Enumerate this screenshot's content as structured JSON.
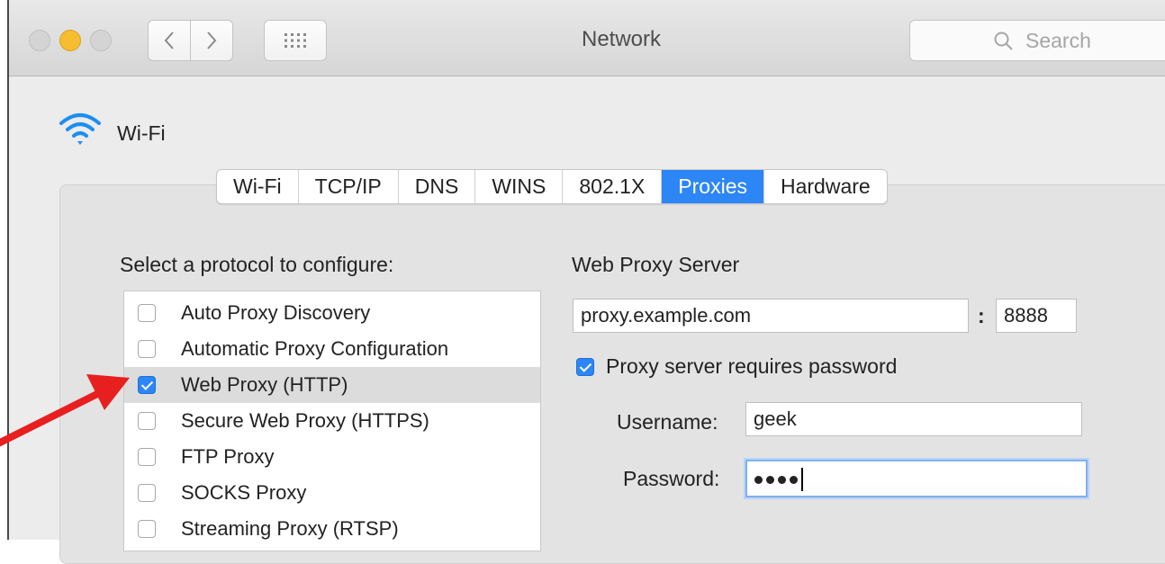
{
  "window": {
    "title": "Network"
  },
  "search": {
    "placeholder": "Search"
  },
  "header": {
    "interface_name": "Wi-Fi"
  },
  "tabs": [
    {
      "label": "Wi-Fi",
      "active": false
    },
    {
      "label": "TCP/IP",
      "active": false
    },
    {
      "label": "DNS",
      "active": false
    },
    {
      "label": "WINS",
      "active": false
    },
    {
      "label": "802.1X",
      "active": false
    },
    {
      "label": "Proxies",
      "active": true
    },
    {
      "label": "Hardware",
      "active": false
    }
  ],
  "protocols": {
    "heading": "Select a protocol to configure:",
    "items": [
      {
        "label": "Auto Proxy Discovery",
        "checked": false,
        "selected": false
      },
      {
        "label": "Automatic Proxy Configuration",
        "checked": false,
        "selected": false
      },
      {
        "label": "Web Proxy (HTTP)",
        "checked": true,
        "selected": true
      },
      {
        "label": "Secure Web Proxy (HTTPS)",
        "checked": false,
        "selected": false
      },
      {
        "label": "FTP Proxy",
        "checked": false,
        "selected": false
      },
      {
        "label": "SOCKS Proxy",
        "checked": false,
        "selected": false
      },
      {
        "label": "Streaming Proxy (RTSP)",
        "checked": false,
        "selected": false
      }
    ]
  },
  "proxy_server": {
    "heading": "Web Proxy Server",
    "host": "proxy.example.com",
    "separator": ":",
    "port": "8888",
    "requires_password_label": "Proxy server requires password",
    "requires_password": true,
    "username_label": "Username:",
    "username": "geek",
    "password_label": "Password:",
    "password_length": 4
  },
  "colors": {
    "accent": "#2c86f5",
    "annotation_arrow": "#e81f1f"
  },
  "icons": {
    "wifi": "wifi-icon",
    "search": "search-icon",
    "back": "chevron-left-icon",
    "forward": "chevron-right-icon",
    "show_all": "grid-icon"
  }
}
